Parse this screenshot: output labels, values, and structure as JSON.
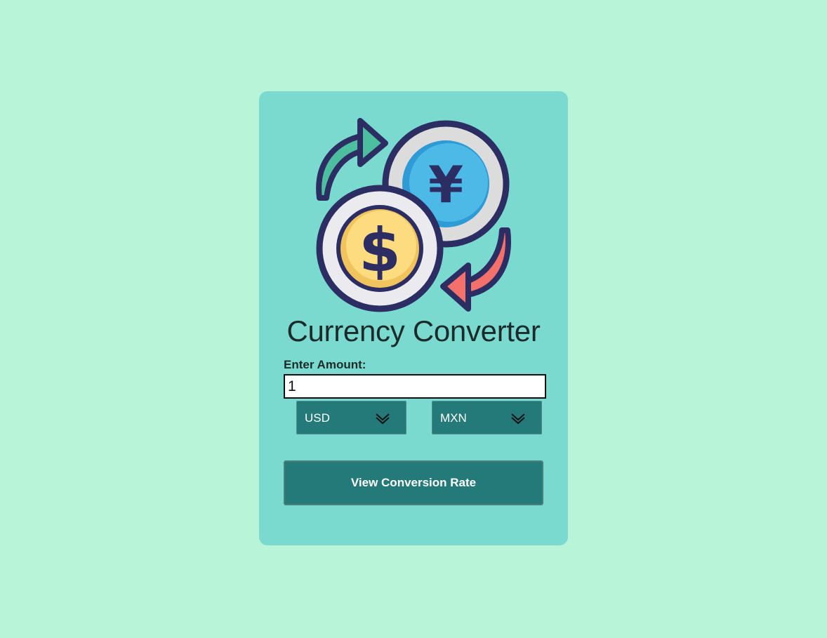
{
  "app": {
    "title": "Currency Converter",
    "logo_icon": "currency-exchange-icon",
    "background_color": "#b7f4d8",
    "card_color": "#7bdacf",
    "accent_color": "#247a78"
  },
  "form": {
    "amount_label": "Enter Amount:",
    "amount_value": "1",
    "from_currency": "USD",
    "to_currency": "MXN",
    "submit_label": "View Conversion Rate"
  },
  "logo": {
    "coin_back_symbol": "¥",
    "coin_front_symbol": "$"
  }
}
